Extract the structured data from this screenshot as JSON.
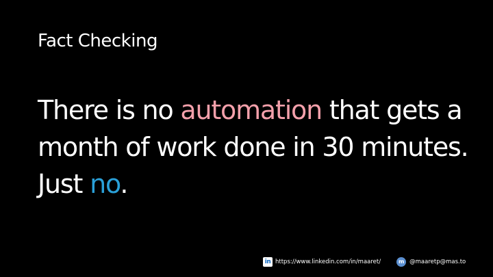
{
  "slide": {
    "title": "Fact Checking",
    "body": {
      "part1": "There is no ",
      "highlight1": "automation",
      "part2": " that gets a month of work done in 30 minutes. Just ",
      "highlight2": "no",
      "part3": "."
    },
    "colors": {
      "background": "#000000",
      "text": "#ffffff",
      "highlight_pink": "#f4a0ab",
      "highlight_blue": "#2aa0d8"
    }
  },
  "footer": {
    "linkedin_icon": "linkedin-icon",
    "linkedin_icon_glyph": "in",
    "linkedin_url": "https://www.linkedin.com/in/maaret/",
    "mastodon_icon": "mastodon-icon",
    "mastodon_icon_glyph": "m",
    "mastodon_handle": "@maaretp@mas.to"
  }
}
